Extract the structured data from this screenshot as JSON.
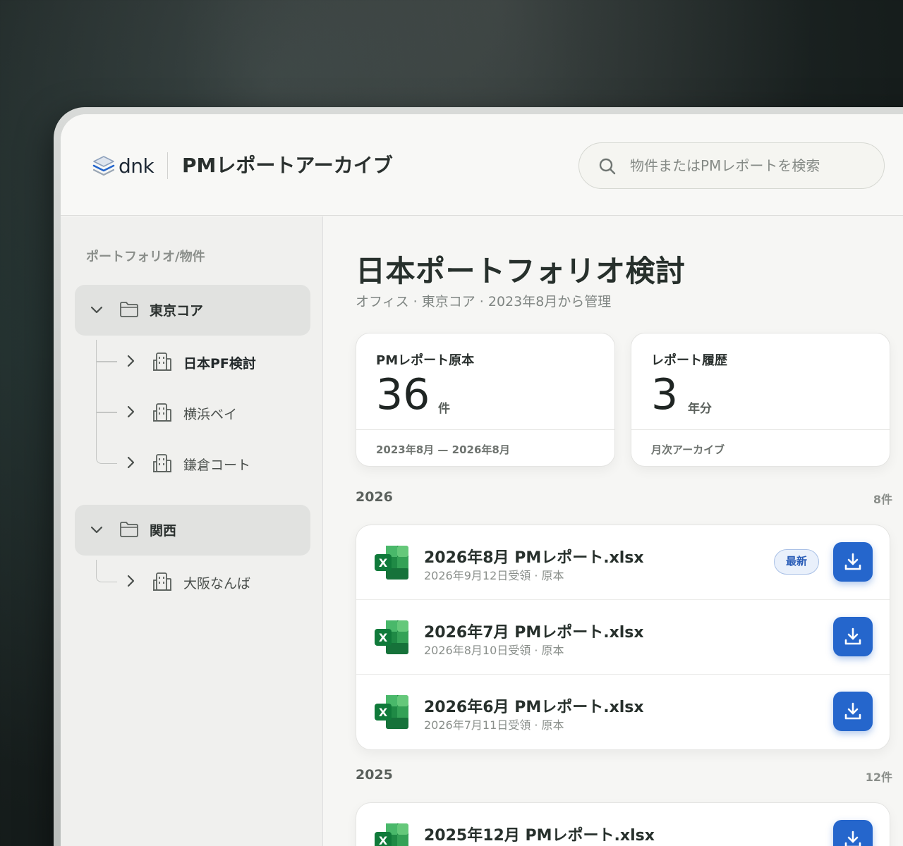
{
  "header": {
    "logo_text": "dnk",
    "app_title": "PMレポートアーカイブ",
    "search_placeholder": "物件またはPMレポートを検索"
  },
  "sidebar": {
    "heading": "ポートフォリオ/物件",
    "groups": [
      {
        "label": "東京コア",
        "items": [
          {
            "label": "日本PF検討",
            "active": true
          },
          {
            "label": "横浜ベイ",
            "active": false
          },
          {
            "label": "鎌倉コート",
            "active": false
          }
        ]
      },
      {
        "label": "関西",
        "items": [
          {
            "label": "大阪なんば",
            "active": false
          }
        ]
      }
    ]
  },
  "main": {
    "title": "日本ポートフォリオ検討",
    "subtitle": "オフィス · 東京コア · 2023年8月から管理",
    "stats": [
      {
        "label": "PMレポート原本",
        "value": "36",
        "unit": "件",
        "footer": "2023年8月 — 2026年8月"
      },
      {
        "label": "レポート履歴",
        "value": "3",
        "unit": "年分",
        "footer": "月次アーカイブ"
      }
    ],
    "years": [
      {
        "year": "2026",
        "count": "8件",
        "files": [
          {
            "name": "2026年8月 PMレポート.xlsx",
            "meta": "2026年9月12日受領 · 原本",
            "badge": "最新"
          },
          {
            "name": "2026年7月 PMレポート.xlsx",
            "meta": "2026年8月10日受領 · 原本",
            "badge": null
          },
          {
            "name": "2026年6月 PMレポート.xlsx",
            "meta": "2026年7月11日受領 · 原本",
            "badge": null
          }
        ]
      },
      {
        "year": "2025",
        "count": "12件",
        "files": [
          {
            "name": "2025年12月 PMレポート.xlsx",
            "meta": "",
            "badge": null
          }
        ]
      }
    ]
  },
  "colors": {
    "accent": "#2566cc",
    "excel_green": "#1f8a45",
    "badge_bg": "#e9f0fb"
  }
}
